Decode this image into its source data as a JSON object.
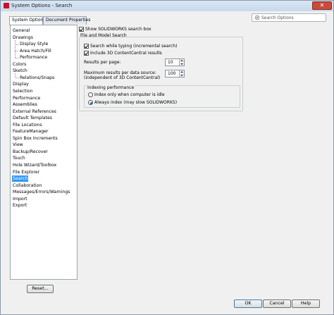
{
  "window": {
    "title": "System Options - Search",
    "close_symbol": "✕"
  },
  "tabs": [
    {
      "label": "System Options"
    },
    {
      "label": "Document Properties"
    }
  ],
  "search": {
    "placeholder": "Search Options"
  },
  "tree": [
    {
      "label": "General"
    },
    {
      "label": "Drawings"
    },
    {
      "label": "Display Style"
    },
    {
      "label": "Area Hatch/Fill"
    },
    {
      "label": "Performance"
    },
    {
      "label": "Colors"
    },
    {
      "label": "Sketch"
    },
    {
      "label": "Relations/Snaps"
    },
    {
      "label": "Display"
    },
    {
      "label": "Selection"
    },
    {
      "label": "Performance"
    },
    {
      "label": "Assemblies"
    },
    {
      "label": "External References"
    },
    {
      "label": "Default Templates"
    },
    {
      "label": "File Locations"
    },
    {
      "label": "FeatureManager"
    },
    {
      "label": "Spin Box Increments"
    },
    {
      "label": "View"
    },
    {
      "label": "Backup/Recover"
    },
    {
      "label": "Touch"
    },
    {
      "label": "Hole Wizard/Toolbox"
    },
    {
      "label": "File Explorer"
    },
    {
      "label": "Search"
    },
    {
      "label": "Collaboration"
    },
    {
      "label": "Messages/Errors/Warnings"
    },
    {
      "label": "Import"
    },
    {
      "label": "Export"
    }
  ],
  "options": {
    "show_search_box": {
      "label": "Show SOLIDWORKS search box",
      "checked": true
    },
    "file_model_group": "File and Model Search",
    "search_while_typing": {
      "label": "Search while typing (incremental search)",
      "checked": true
    },
    "include_content_central": {
      "label": "Include 3D ContentCentral results",
      "checked": true
    },
    "results_per_page": {
      "label": "Results per page:",
      "value": "10"
    },
    "max_results": {
      "label_line1": "Maximum results per data source:",
      "label_line2": "(independent of 3D ContentCentral)",
      "value": "100"
    },
    "indexing": {
      "title": "Indexing performance",
      "idle_label": "Index only when computer is idle",
      "always_label": "Always index (may slow SOLIDWORKS)",
      "selected": "always"
    }
  },
  "buttons": {
    "reset": "Reset...",
    "ok": "OK",
    "cancel": "Cancel",
    "help": "Help"
  },
  "colors": {
    "selection": "#3399ff",
    "close": "#c94b3c"
  }
}
